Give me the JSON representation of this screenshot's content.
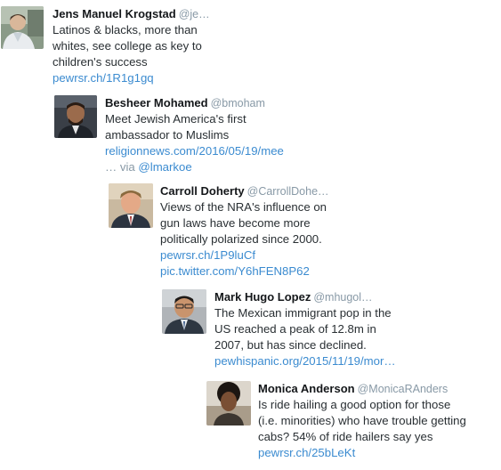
{
  "tweets": [
    {
      "name": "Jens Manuel Krogstad",
      "handle": "@je…",
      "avatar_icon": "person-photo-avatar",
      "lines": [
        "Latinos & blacks, more than",
        "whites, see college as key to",
        "children's success"
      ],
      "links": [
        "pewrsr.ch/1R1g1gq"
      ]
    },
    {
      "name": "Besheer Mohamed",
      "handle": "@bmoham",
      "avatar_icon": "person-photo-avatar",
      "lines": [
        "Meet Jewish America's first",
        "ambassador to Muslims"
      ],
      "links": [
        "religionnews.com/2016/05/19/mee"
      ],
      "via_prefix": "… via ",
      "via_handle": "@lmarkoe"
    },
    {
      "name": "Carroll Doherty",
      "handle": "@CarrollDohe…",
      "avatar_icon": "person-photo-avatar",
      "lines": [
        "Views of the NRA's influence on",
        "gun laws have become more",
        "politically polarized since 2000."
      ],
      "links": [
        "pewrsr.ch/1P9luCf",
        "pic.twitter.com/Y6hFEN8P62"
      ]
    },
    {
      "name": "Mark Hugo Lopez",
      "handle": "@mhugol…",
      "avatar_icon": "person-photo-avatar",
      "lines": [
        "The Mexican immigrant pop in the",
        "US reached a peak of 12.8m in",
        "2007, but has since declined."
      ],
      "links": [
        "pewhispanic.org/2015/11/19/mor…"
      ]
    },
    {
      "name": "Monica Anderson",
      "handle": "@MonicaRAnders",
      "avatar_icon": "person-photo-avatar",
      "lines": [
        "Is ride hailing a good option for those",
        "(i.e. minorities) who have trouble getting",
        "cabs? 54% of ride hailers say yes"
      ],
      "links": [
        "pewrsr.ch/25bLeKt"
      ]
    }
  ],
  "colors": {
    "link": "#3b8bd0",
    "name": "#14171a",
    "handle": "#8899a6",
    "text": "#292f33"
  }
}
